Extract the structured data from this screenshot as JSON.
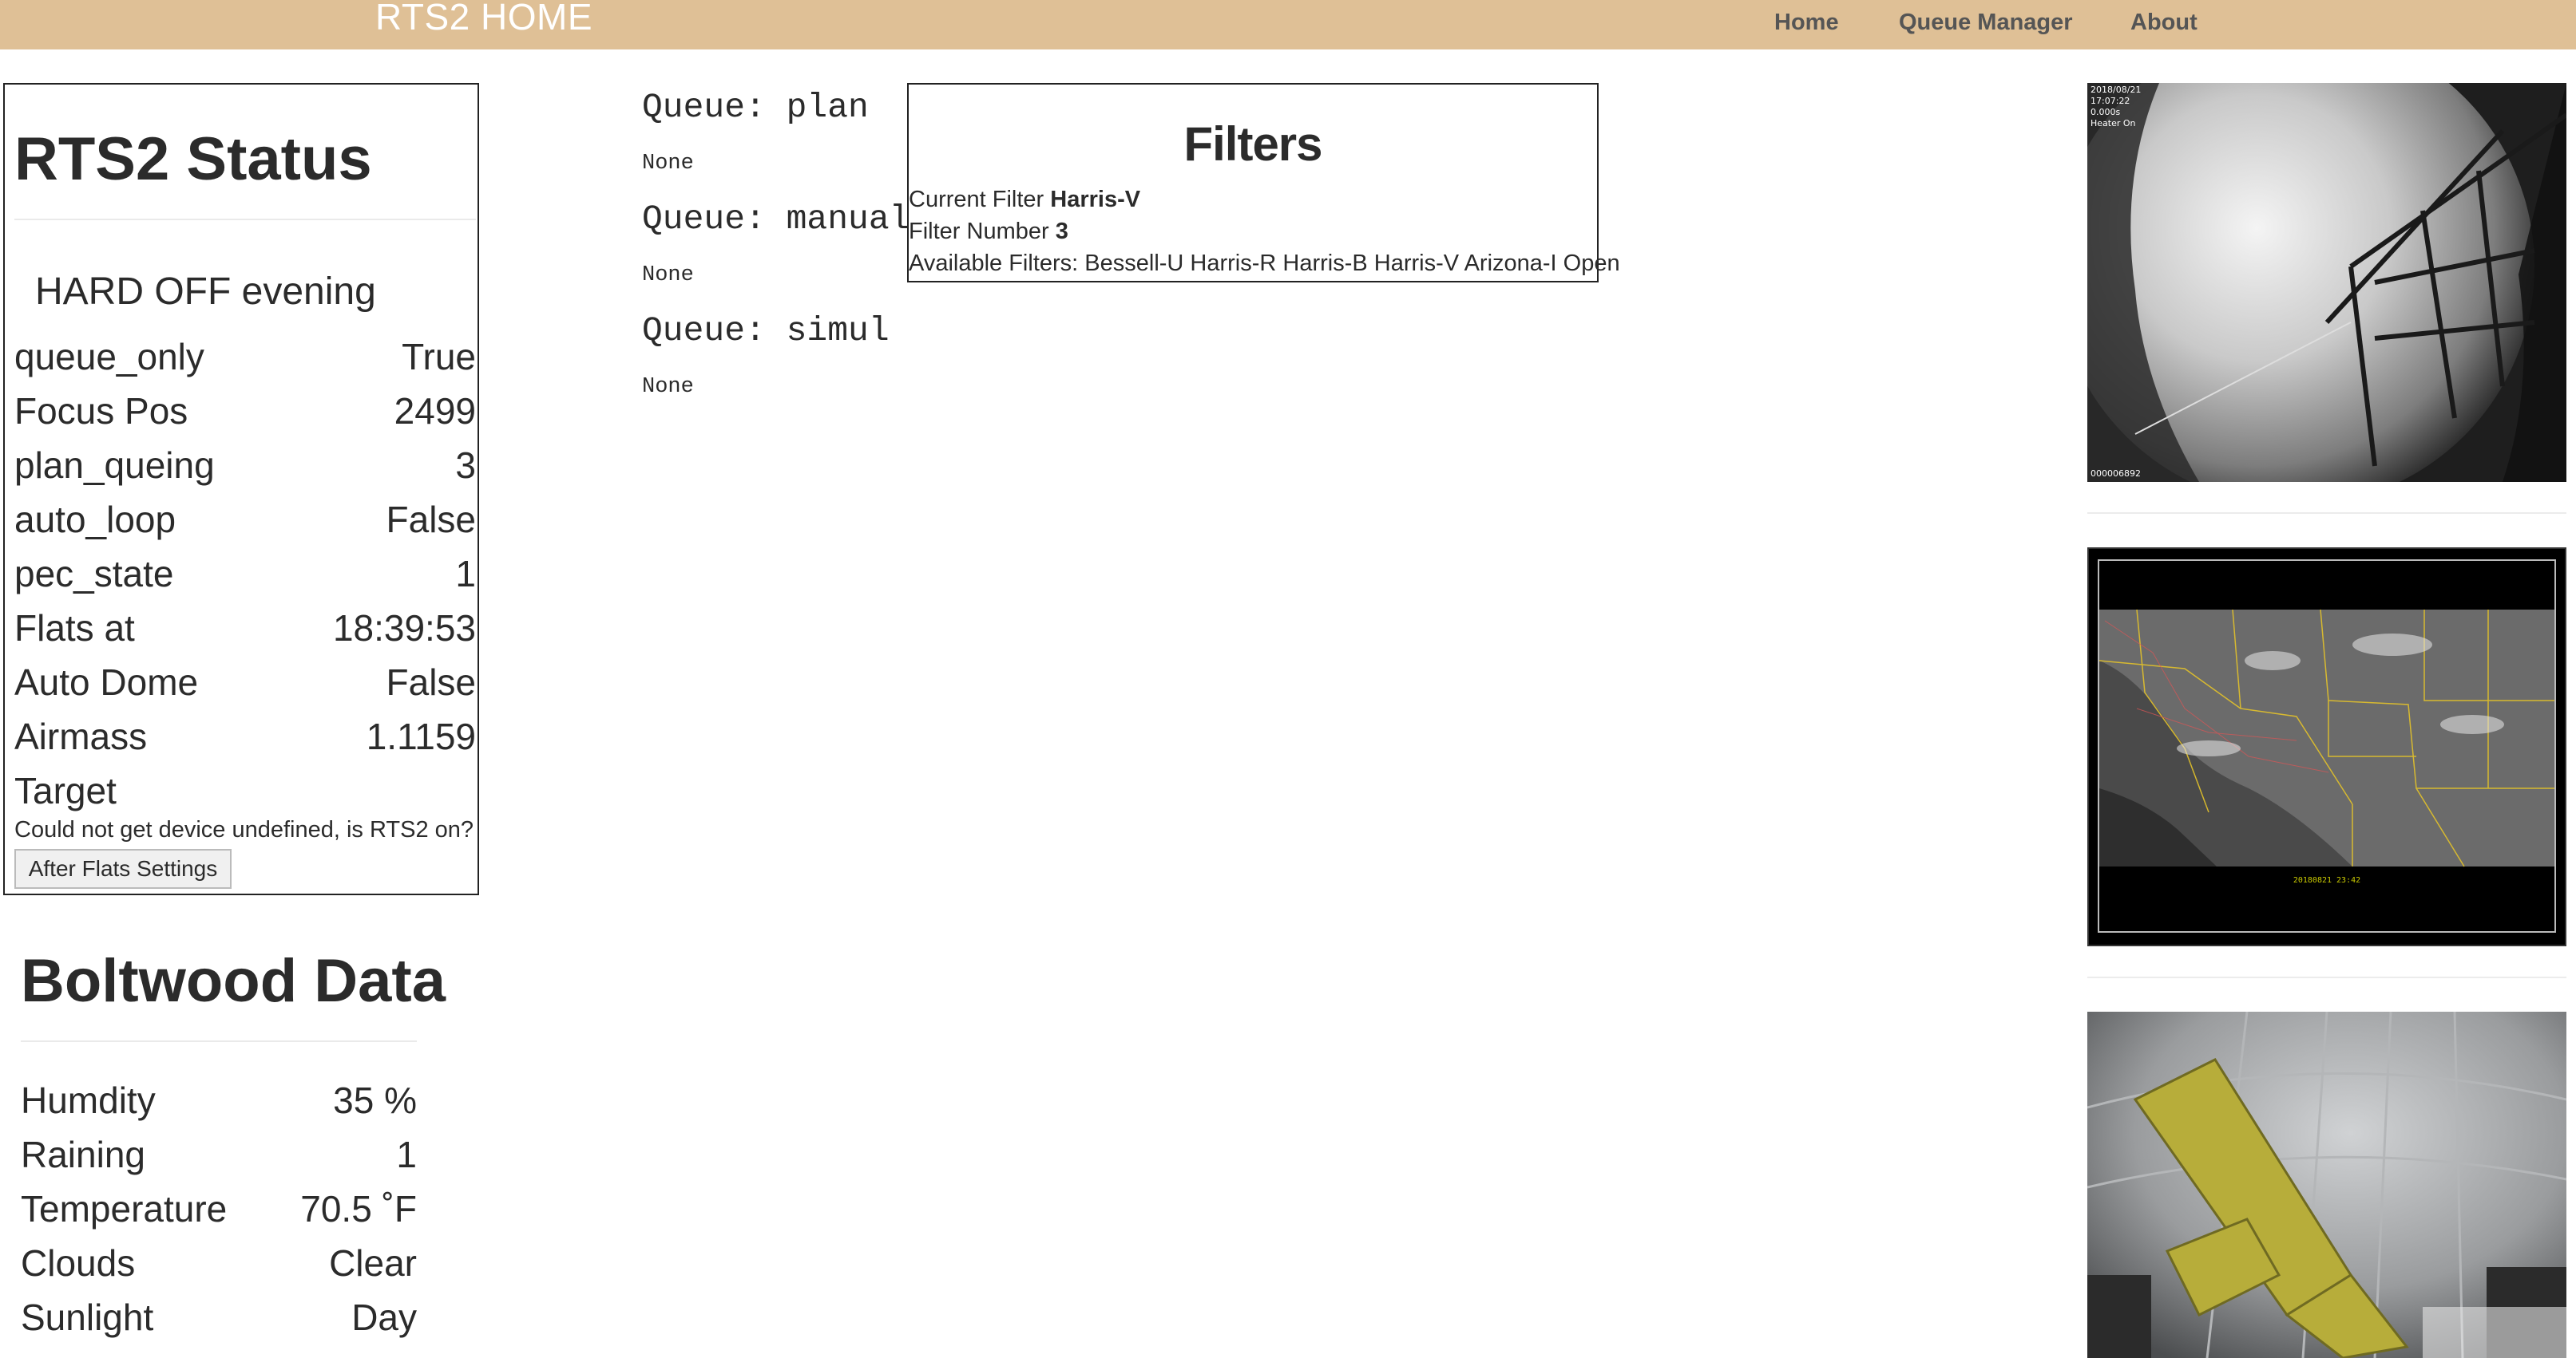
{
  "nav": {
    "brand": "RTS2 HOME",
    "links": [
      "Home",
      "Queue Manager",
      "About"
    ]
  },
  "status": {
    "title": "RTS2 Status",
    "state": "HARD OFF evening",
    "rows": [
      {
        "key": "queue_only",
        "value": "True"
      },
      {
        "key": "Focus Pos",
        "value": "2499"
      },
      {
        "key": "plan_queing",
        "value": "3"
      },
      {
        "key": "auto_loop",
        "value": "False"
      },
      {
        "key": "pec_state",
        "value": "1"
      },
      {
        "key": "Flats at",
        "value": "18:39:53"
      },
      {
        "key": "Auto Dome",
        "value": "False"
      },
      {
        "key": "Airmass",
        "value": "1.1159"
      },
      {
        "key": "Target",
        "value": ""
      }
    ],
    "target_message": "Could not get device undefined, is RTS2 on?",
    "after_flats_button": "After Flats Settings"
  },
  "boltwood": {
    "title": "Boltwood Data",
    "rows": [
      {
        "key": "Humdity",
        "value": "35 %"
      },
      {
        "key": "Raining",
        "value": "1"
      },
      {
        "key": "Temperature",
        "value": "70.5 ˚F"
      },
      {
        "key": "Clouds",
        "value": "Clear"
      },
      {
        "key": "Sunlight",
        "value": "Day"
      }
    ]
  },
  "queues": [
    {
      "name": "Queue: plan",
      "value": "None"
    },
    {
      "name": "Queue: manual",
      "value": "None"
    },
    {
      "name": "Queue: simul",
      "value": "None"
    }
  ],
  "filters": {
    "title": "Filters",
    "current_label": "Current Filter ",
    "current_value": "Harris-V",
    "number_label": "Filter Number ",
    "number_value": "3",
    "available": "Available Filters: Bessell-U Harris-R Harris-B Harris-V Arizona-I Open"
  },
  "webcams": {
    "cam1_overlay": [
      "2018/08/21",
      "17:07:22",
      "0.000s",
      "Heater On"
    ],
    "cam1_footer": "000006892",
    "cam2_caption": "20180821 23:42"
  }
}
